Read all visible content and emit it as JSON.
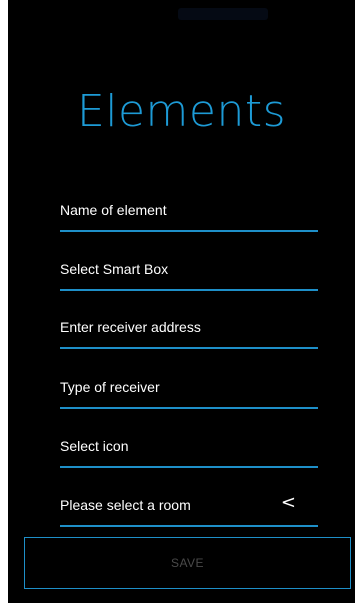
{
  "header": {
    "title": "Elements"
  },
  "form": {
    "fields": [
      {
        "label": "Name of element"
      },
      {
        "label": "Select Smart Box"
      },
      {
        "label": "Enter receiver address"
      },
      {
        "label": "Type of receiver"
      },
      {
        "label": "Select icon"
      },
      {
        "label": "Please select a room",
        "icon": "chevron-left-icon",
        "glyph": "<"
      }
    ],
    "save_label": "SAVE"
  },
  "colors": {
    "background": "#000000",
    "accent": "#1e8fc8",
    "title": "#1d9bd6",
    "text": "#ffffff",
    "disabled_text": "#4a4a4a"
  }
}
